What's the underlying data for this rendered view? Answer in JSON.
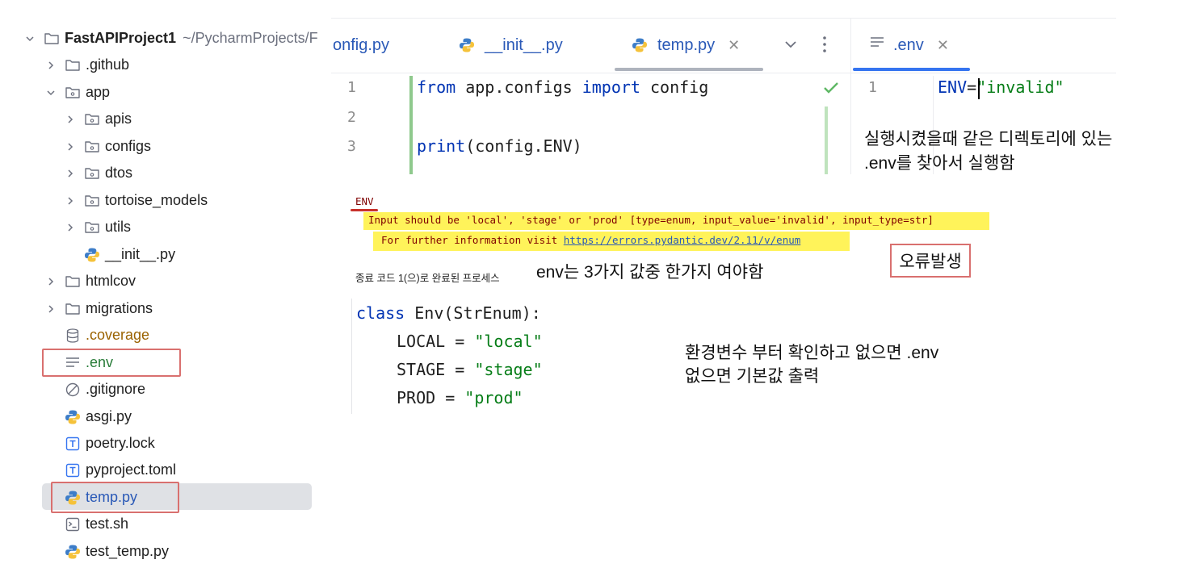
{
  "project": {
    "root_name": "FastAPIProject1",
    "root_path": "~/PycharmProjects/F",
    "items": [
      {
        "label": ".github",
        "kind": "folder"
      },
      {
        "label": "app",
        "kind": "package"
      },
      {
        "label": "apis",
        "kind": "package"
      },
      {
        "label": "configs",
        "kind": "package"
      },
      {
        "label": "dtos",
        "kind": "package"
      },
      {
        "label": "tortoise_models",
        "kind": "package"
      },
      {
        "label": "utils",
        "kind": "package"
      },
      {
        "label": "__init__.py",
        "kind": "python"
      },
      {
        "label": "htmlcov",
        "kind": "folder"
      },
      {
        "label": "migrations",
        "kind": "folder"
      },
      {
        "label": ".coverage",
        "kind": "database"
      },
      {
        "label": ".env",
        "kind": "text"
      },
      {
        "label": ".gitignore",
        "kind": "ignore"
      },
      {
        "label": "asgi.py",
        "kind": "python"
      },
      {
        "label": "poetry.lock",
        "kind": "toml"
      },
      {
        "label": "pyproject.toml",
        "kind": "toml"
      },
      {
        "label": "temp.py",
        "kind": "python"
      },
      {
        "label": "test.sh",
        "kind": "shell"
      },
      {
        "label": "test_temp.py",
        "kind": "python"
      }
    ]
  },
  "editor": {
    "tabs": [
      {
        "label": "onfig.py"
      },
      {
        "label": "__init__.py"
      },
      {
        "label": "temp.py",
        "active": true
      }
    ],
    "env_tab": ".env",
    "lines": [
      {
        "n": "1",
        "kw1": "from",
        "mid": " app.configs ",
        "kw2": "import",
        "rest": " config"
      },
      {
        "n": "2"
      },
      {
        "n": "3",
        "kw1": "print",
        "rest": "(config.ENV)"
      }
    ],
    "env_line": {
      "n": "1",
      "key": "ENV",
      "eq": "=",
      "value": "\"invalid\""
    }
  },
  "console": {
    "field": "ENV",
    "error": "Input should be 'local', 'stage' or 'prod' [type=enum, input_value='invalid', input_type=str]",
    "info_prefix": "For further information visit ",
    "info_link": "https://errors.pydantic.dev/2.11/v/enum",
    "exit": "종료 코드 1(으)로 완료된 프로세스"
  },
  "enum_code": {
    "header_kw": "class",
    "header_rest": " Env(StrEnum):",
    "members": [
      {
        "name": "LOCAL",
        "value": "\"local\""
      },
      {
        "name": "STAGE",
        "value": "\"stage\""
      },
      {
        "name": "PROD",
        "value": "\"prod\""
      }
    ]
  },
  "annotations": {
    "run_note_1": "실행시켰을때 같은 디렉토리에 있는",
    "run_note_2": ".env를 찾아서 실행함",
    "error_label": "오류발생",
    "enum_note": "env는 3가지 값중 한가지 여야함",
    "fallback_1": "환경변수 부터 확인하고 없으면 .env",
    "fallback_2": "없으면 기본값 출력"
  },
  "colors": {
    "link": "#2a59b7",
    "keyword": "#0033b3",
    "string": "#067d17",
    "console_text": "#7f0000",
    "highlight": "#fff35a",
    "annotation_box": "#d9706f"
  }
}
